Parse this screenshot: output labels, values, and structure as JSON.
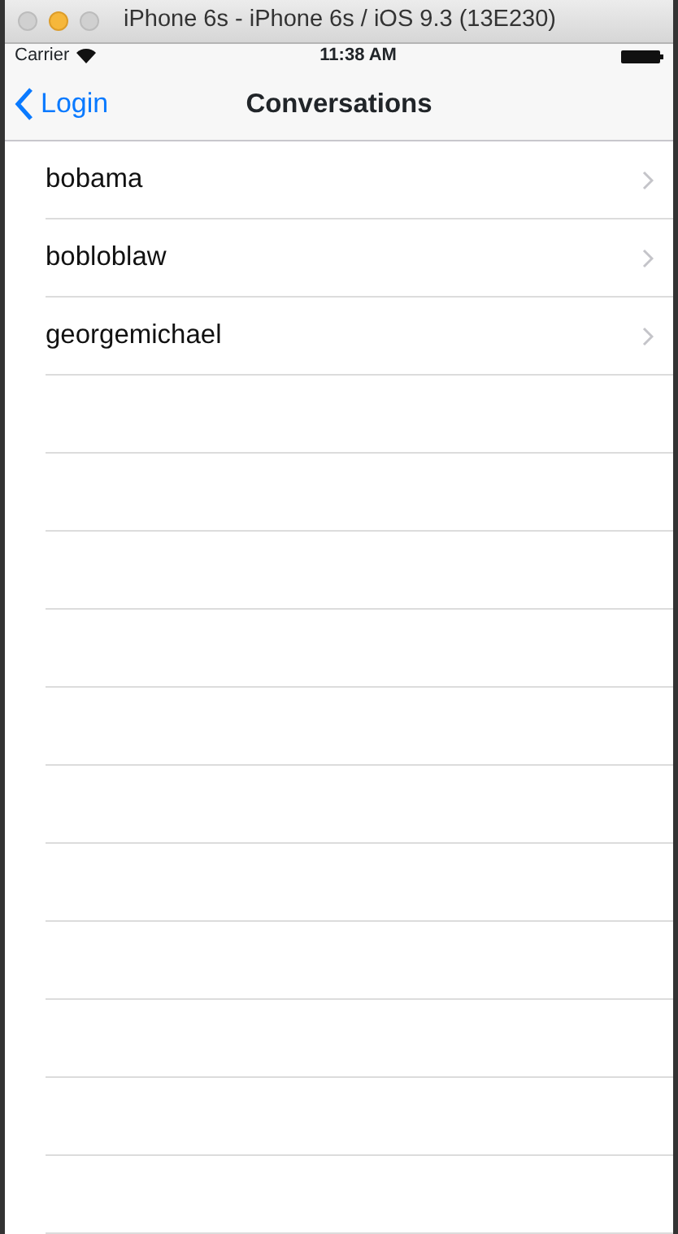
{
  "window": {
    "title": "iPhone 6s - iPhone 6s / iOS 9.3 (13E230)"
  },
  "status_bar": {
    "carrier": "Carrier",
    "time": "11:38 AM"
  },
  "nav_bar": {
    "back": "Login",
    "title": "Conversations"
  },
  "conversations": [
    {
      "name": "bobama"
    },
    {
      "name": "bobloblaw"
    },
    {
      "name": "georgemichael"
    }
  ]
}
